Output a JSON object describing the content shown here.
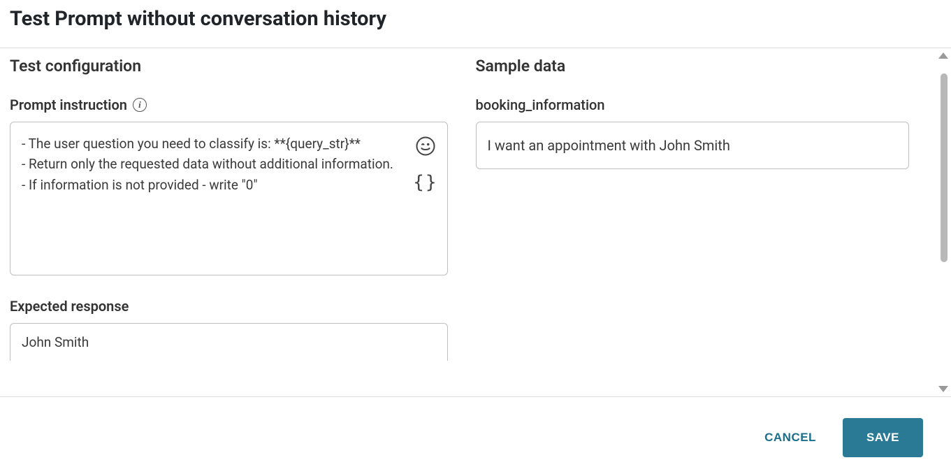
{
  "dialog": {
    "title": "Test Prompt without conversation history"
  },
  "left": {
    "section_heading": "Test configuration",
    "prompt_label": "Prompt instruction",
    "prompt_value": "- The user question you need to classify is: **{query_str}**\n- Return only the requested data without additional information.\n- If information is not provided - write \"0\"",
    "expected_label": "Expected response",
    "expected_value": "John Smith"
  },
  "right": {
    "section_heading": "Sample data",
    "field_label": "booking_information",
    "field_value": "I want an appointment with John Smith"
  },
  "footer": {
    "cancel": "CANCEL",
    "save": "SAVE"
  }
}
